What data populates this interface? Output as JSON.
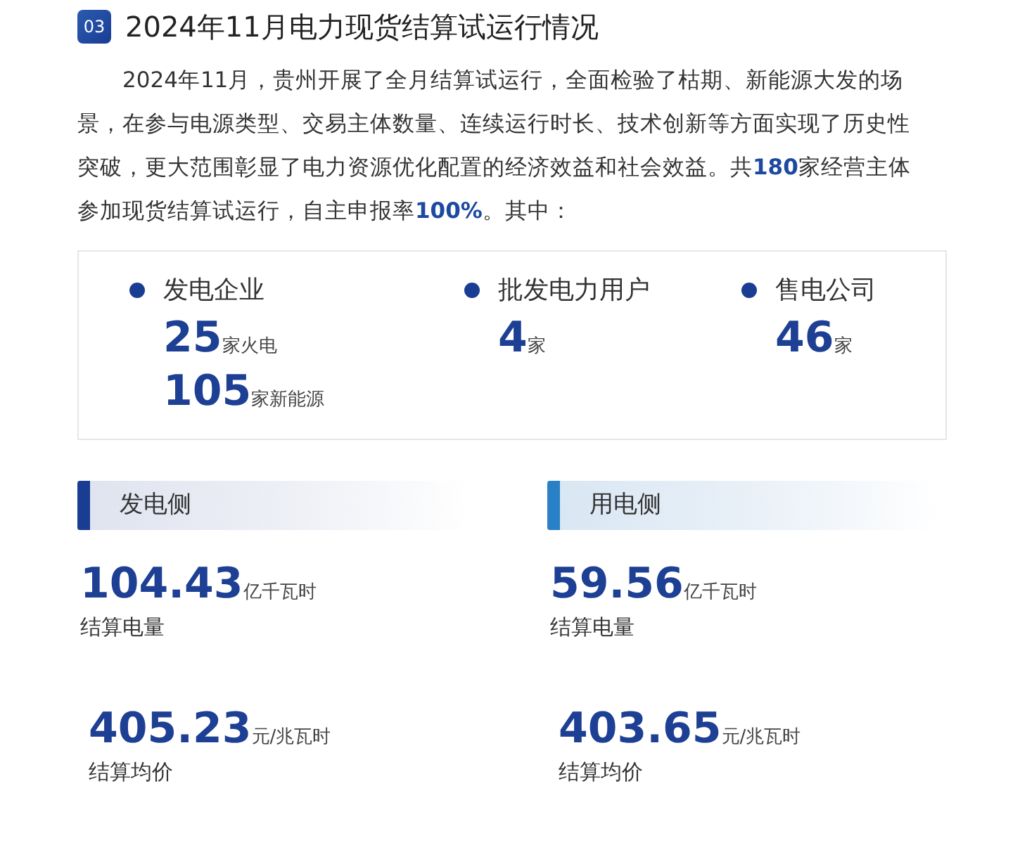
{
  "section": {
    "number": "03",
    "title": "2024年11月电力现货结算试运行情况"
  },
  "intro": "2024年11月，贵州开展了全月结算试运行，全面检验了枯期、新能源大发的场景，在参与电源类型、交易主体数量、连续运行时长、技术创新等方面实现了历史性突破，更大范围彰显了电力资源优化配置的经济效益和社会效益。共**180**家经营主体参加现货结算试运行，自主申报率**100%**。其中：",
  "participants": [
    {
      "label": "发电企业",
      "counts": [
        {
          "value": "25",
          "unit": "家火电"
        },
        {
          "value": "105",
          "unit": "家新能源"
        }
      ]
    },
    {
      "label": "批发电力用户",
      "counts": [
        {
          "value": "4",
          "unit": "家"
        }
      ]
    },
    {
      "label": "售电公司",
      "counts": [
        {
          "value": "46",
          "unit": "家"
        }
      ]
    }
  ],
  "sides": [
    {
      "title": "发电侧",
      "kind": "generation",
      "metrics": [
        {
          "value": "104.43",
          "unit": "亿千瓦时",
          "label": "结算电量"
        },
        {
          "value": "405.23",
          "unit": "元/兆瓦时",
          "label": "结算均价"
        }
      ]
    },
    {
      "title": "用电侧",
      "kind": "consumption",
      "metrics": [
        {
          "value": "59.56",
          "unit": "亿千瓦时",
          "label": "结算电量"
        },
        {
          "value": "403.65",
          "unit": "元/兆瓦时",
          "label": "结算均价"
        }
      ]
    }
  ]
}
